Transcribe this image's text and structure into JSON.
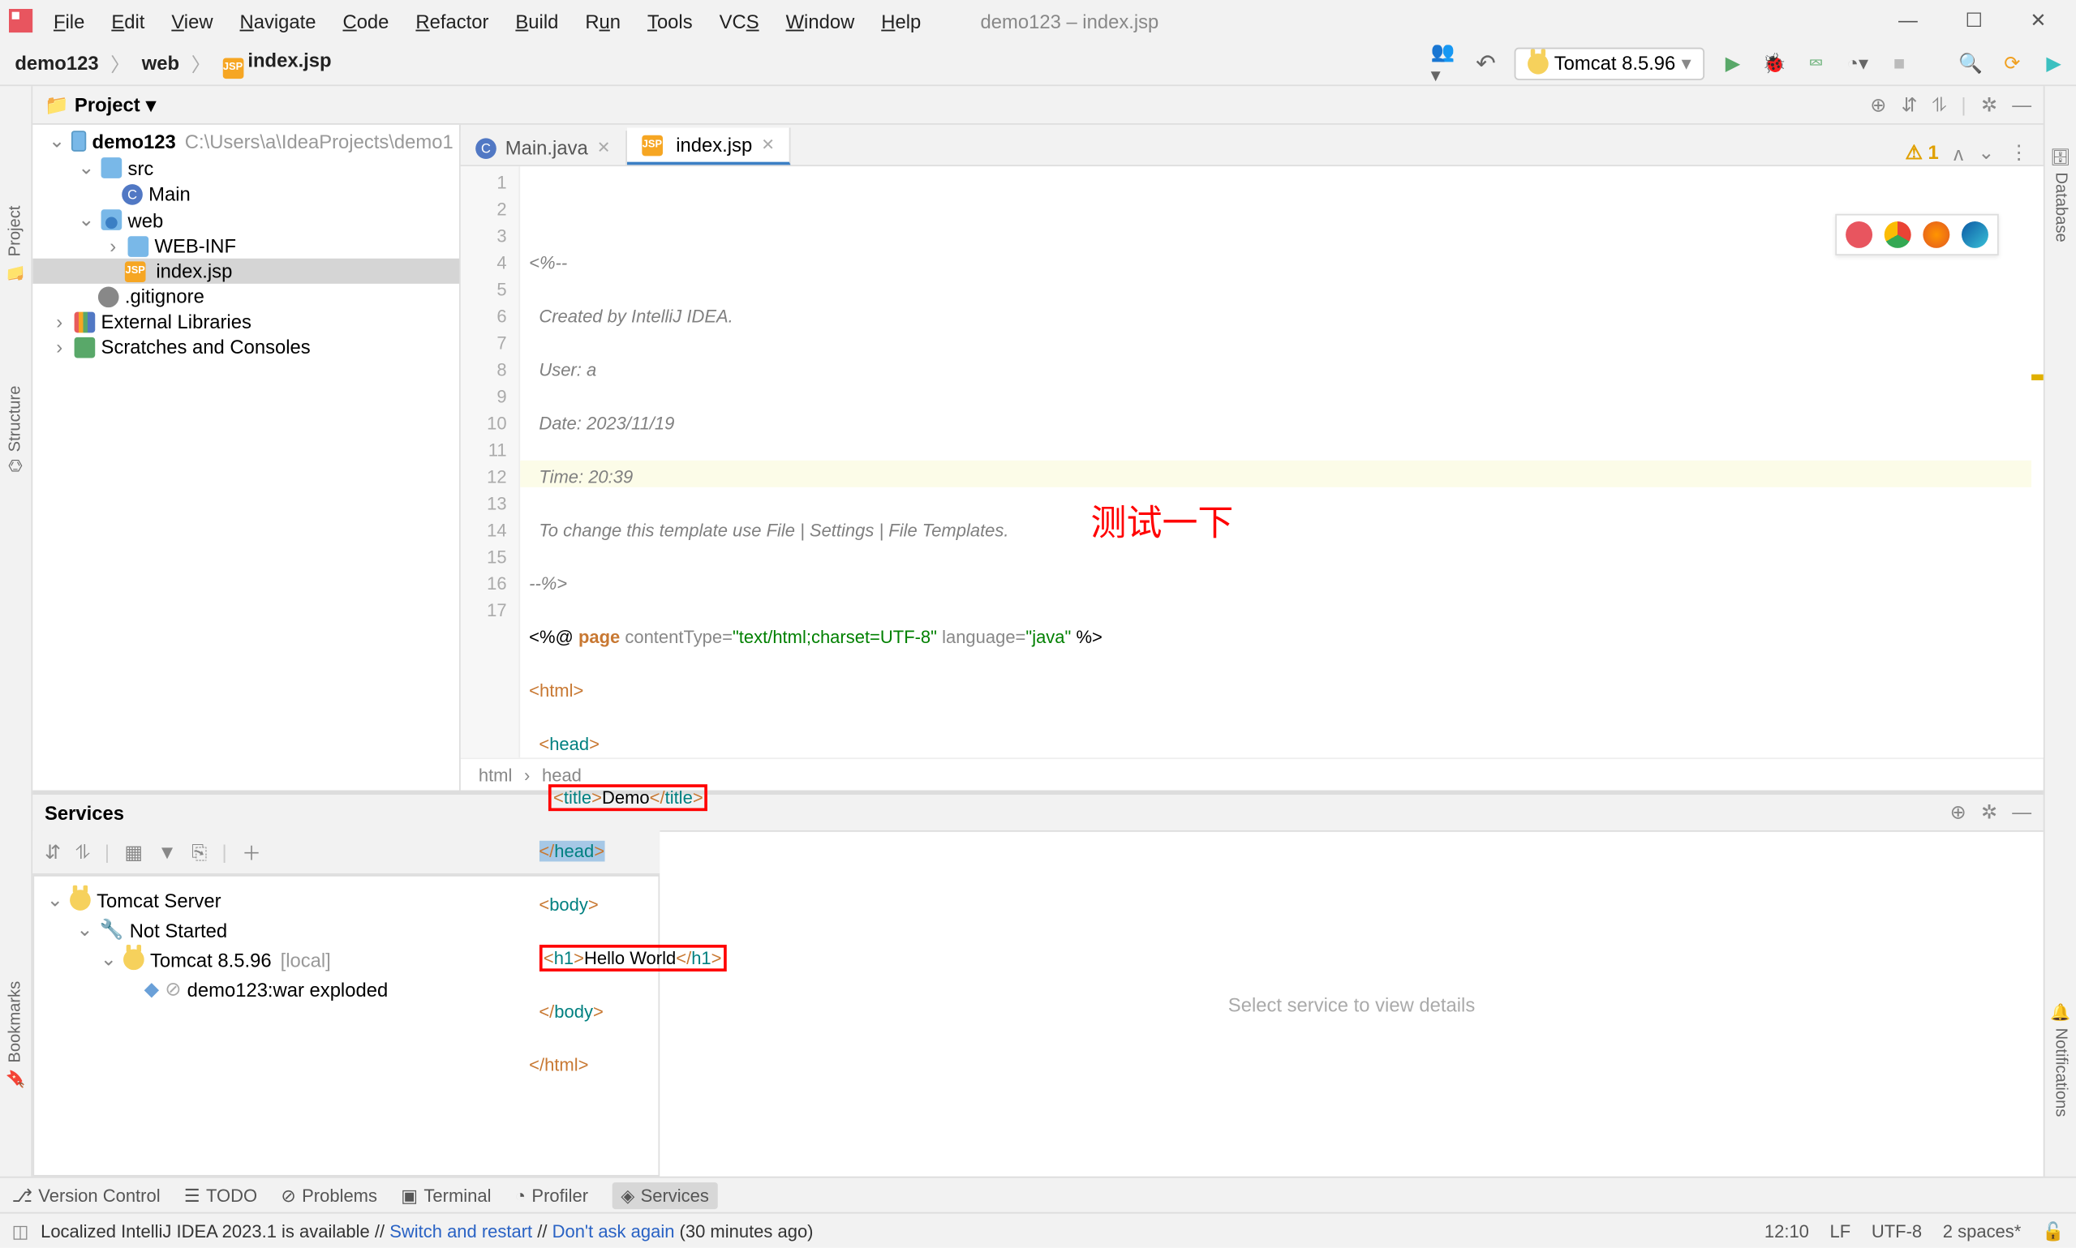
{
  "window": {
    "title": "demo123 – index.jsp"
  },
  "menu": [
    "File",
    "Edit",
    "View",
    "Navigate",
    "Code",
    "Refactor",
    "Build",
    "Run",
    "Tools",
    "VCS",
    "Window",
    "Help"
  ],
  "breadcrumb": {
    "project": "demo123",
    "folder": "web",
    "file": "index.jsp"
  },
  "run_config": "Tomcat 8.5.96",
  "side_tools": {
    "project": "Project",
    "structure": "Structure",
    "bookmarks": "Bookmarks",
    "database": "Database",
    "notifications": "Notifications"
  },
  "project_panel": {
    "title": "Project"
  },
  "tree": {
    "root": "demo123",
    "root_path": "C:\\Users\\a\\IdeaProjects\\demo1",
    "src": "src",
    "main_class": "Main",
    "web": "web",
    "webinf": "WEB-INF",
    "indexjsp": "index.jsp",
    "gitignore": ".gitignore",
    "ext_lib": "External Libraries",
    "scratch": "Scratches and Consoles"
  },
  "tabs": {
    "main": "Main.java",
    "index": "index.jsp"
  },
  "editor_warning_count": "1",
  "code": {
    "l1": "<%--",
    "l2": "  Created by IntelliJ IDEA.",
    "l3": "  User: a",
    "l4": "  Date: 2023/11/19",
    "l5": "  Time: 20:39",
    "l6": "  To change this template use File | Settings | File Templates.",
    "l7": "--%>",
    "l8_pre": "<%@ ",
    "l8_page": "page",
    "l8_ct": " contentType=",
    "l8_ctv": "\"text/html;charset=UTF-8\"",
    "l8_lang": " language=",
    "l8_langv": "\"java\"",
    "l8_post": " %>",
    "l9_open": "<",
    "l9_tag": "html",
    "l9_close": ">",
    "l10_open": "<",
    "l10_tag": "head",
    "l10_close": ">",
    "l11_open": "<",
    "l11_tag": "title",
    "l11_close": ">",
    "l11_text": "Demo",
    "l11_copen": "</",
    "l11_ctag": "title",
    "l11_cclose": ">",
    "l12_open": "</",
    "l12_tag": "head",
    "l12_close": ">",
    "l13_open": "<",
    "l13_tag": "body",
    "l13_close": ">",
    "l14_open": "<",
    "l14_tag": "h1",
    "l14_close": ">",
    "l14_text": "Hello World",
    "l14_copen": "</",
    "l14_ctag": "h1",
    "l14_cclose": ">",
    "l15_open": "</",
    "l15_tag": "body",
    "l15_close": ">",
    "l16_open": "</",
    "l16_tag": "html",
    "l16_close": ">"
  },
  "line_numbers": [
    "1",
    "2",
    "3",
    "4",
    "5",
    "6",
    "7",
    "8",
    "9",
    "10",
    "11",
    "12",
    "13",
    "14",
    "15",
    "16",
    "17"
  ],
  "crumb_bar": {
    "a": "html",
    "b": "head"
  },
  "annotation_text": "测试一下",
  "services": {
    "title": "Services",
    "placeholder": "Select service to view details",
    "root": "Tomcat Server",
    "status": "Not Started",
    "node": "Tomcat 8.5.96",
    "node_suffix": "[local]",
    "artifact": "demo123:war exploded"
  },
  "bottom_tools": {
    "vcs": "Version Control",
    "todo": "TODO",
    "problems": "Problems",
    "terminal": "Terminal",
    "profiler": "Profiler",
    "services": "Services"
  },
  "status": {
    "msg_a": "Localized IntelliJ IDEA 2023.1 is available // ",
    "msg_link1": "Switch and restart",
    "msg_b": " // ",
    "msg_link2": "Don't ask again",
    "msg_c": " (30 minutes ago)",
    "pos": "12:10",
    "lf": "LF",
    "enc": "UTF-8",
    "indent": "2 spaces*"
  }
}
